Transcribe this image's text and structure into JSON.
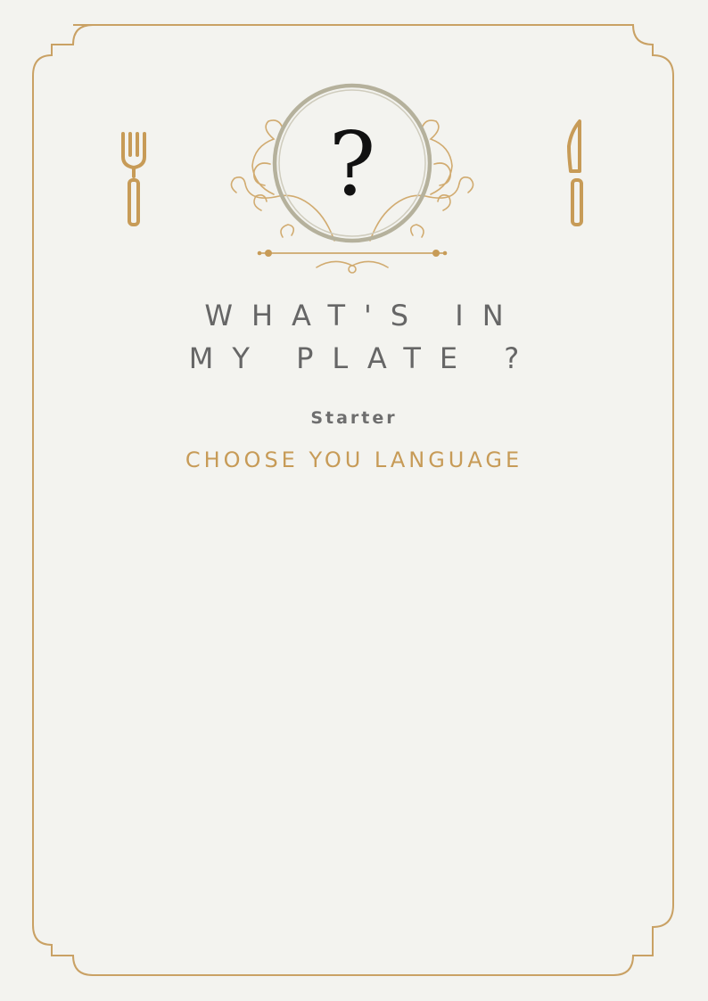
{
  "menu": {
    "title": "WHAT'S IN MY PLATE ?",
    "course": "Starter",
    "language_link": "CHOOSE YOU LANGUAGE",
    "plate_symbol": "?"
  },
  "icons": {
    "left": "fork-icon",
    "right": "knife-icon",
    "center": "plate-ornament-icon"
  },
  "colors": {
    "background": "#f3f3ef",
    "gold": "#c79b57",
    "border": "#c9a164",
    "title_text": "#666666",
    "plate_ring": "#b5b19c"
  }
}
